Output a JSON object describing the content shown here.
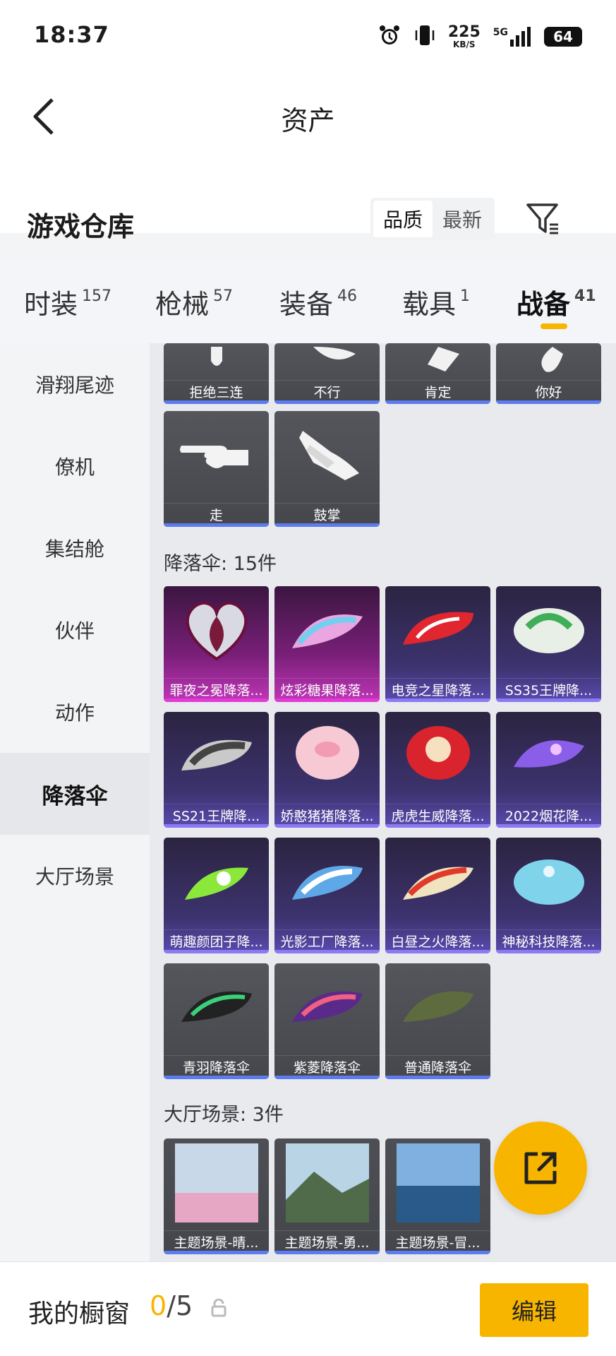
{
  "status": {
    "time": "18:37",
    "speed": "225",
    "speed_unit": "KB/S",
    "network": "5G",
    "battery": "64"
  },
  "header": {
    "title": "资产",
    "section": "游戏仓库",
    "sort_options": [
      "品质",
      "最新"
    ],
    "active_sort": "品质"
  },
  "category_tabs": [
    {
      "label": "时装",
      "count": "157"
    },
    {
      "label": "枪械",
      "count": "57"
    },
    {
      "label": "装备",
      "count": "46"
    },
    {
      "label": "载具",
      "count": "1"
    },
    {
      "label": "战备",
      "count": "41",
      "active": true
    }
  ],
  "sidebar": [
    "滑翔尾迹",
    "僚机",
    "集结舱",
    "伙伴",
    "动作",
    "降落伞",
    "大厅场景"
  ],
  "sidebar_active": "降落伞",
  "emotes": [
    "拒绝三连",
    "不行",
    "肯定",
    "你好",
    "走",
    "鼓掌"
  ],
  "parachute_group": {
    "title": "降落伞: 15件",
    "items": [
      {
        "name": "罪夜之冕降落...",
        "rarity": "pink"
      },
      {
        "name": "炫彩糖果降落...",
        "rarity": "pink"
      },
      {
        "name": "电竞之星降落...",
        "rarity": "purple"
      },
      {
        "name": "SS35王牌降...",
        "rarity": "purple"
      },
      {
        "name": "SS21王牌降...",
        "rarity": "purple"
      },
      {
        "name": "娇憨猪猪降落...",
        "rarity": "purple"
      },
      {
        "name": "虎虎生威降落...",
        "rarity": "purple"
      },
      {
        "name": "2022烟花降...",
        "rarity": "purple"
      },
      {
        "name": "萌趣颜团子降...",
        "rarity": "purple"
      },
      {
        "name": "光影工厂降落...",
        "rarity": "purple"
      },
      {
        "name": "白昼之火降落...",
        "rarity": "purple"
      },
      {
        "name": "神秘科技降落...",
        "rarity": "purple"
      },
      {
        "name": "青羽降落伞",
        "rarity": "gray"
      },
      {
        "name": "紫菱降落伞",
        "rarity": "gray"
      },
      {
        "name": "普通降落伞",
        "rarity": "gray"
      }
    ]
  },
  "scene_group": {
    "title": "大厅场景: 3件",
    "items": [
      "主题场景-晴...",
      "主题场景-勇...",
      "主题场景-冒..."
    ]
  },
  "bottom": {
    "showcase_label": "我的橱窗",
    "count_current": "0",
    "count_rest": "/5",
    "edit_label": "编辑"
  },
  "colors": {
    "accent": "#f7b500",
    "rarity_purple": "#5a4bb0",
    "rarity_pink": "#c036b8",
    "rarity_gray": "#4a4c52"
  }
}
